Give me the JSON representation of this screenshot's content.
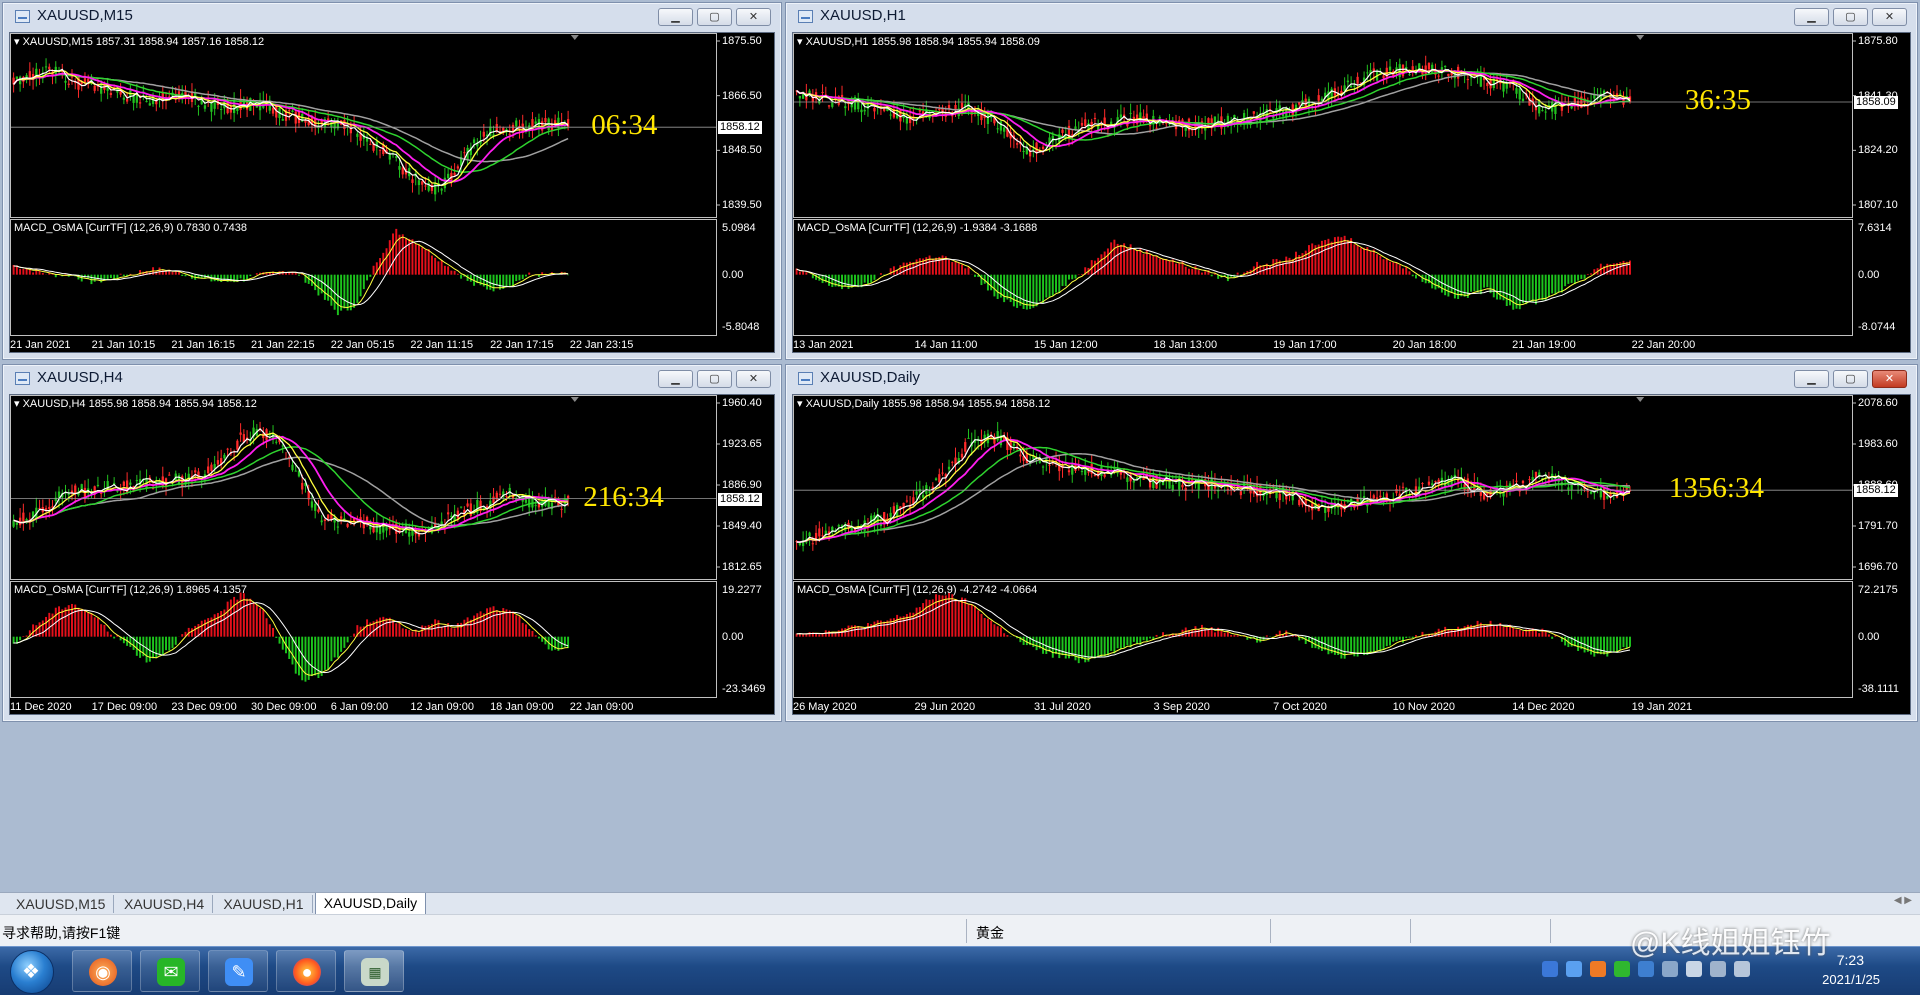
{
  "windows": [
    {
      "id": "m15",
      "title": "XAUUSD,M15",
      "info_line": "XAUUSD,M15  1857.31 1858.94 1857.16 1858.12",
      "timer": "06:34",
      "price_tag": "1858.12",
      "price_axis": [
        "1875.50",
        "1866.50",
        "1848.50",
        "1839.50"
      ],
      "macd_label": "MACD_OsMA [CurrTF] (12,26,9) 0.7830 0.7438",
      "macd_axis": [
        "5.0984",
        "0.00",
        "-5.8048"
      ],
      "time_axis": [
        "21 Jan 2021",
        "21 Jan 10:15",
        "21 Jan 16:15",
        "21 Jan 22:15",
        "22 Jan 05:15",
        "22 Jan 11:15",
        "22 Jan 17:15",
        "22 Jan 23:15"
      ],
      "close_red": false
    },
    {
      "id": "h1",
      "title": "XAUUSD,H1",
      "info_line": "XAUUSD,H1  1855.98 1858.94 1855.94 1858.09",
      "timer": "36:35",
      "price_tag": "1858.09",
      "price_axis": [
        "1875.80",
        "1841.30",
        "1824.20",
        "1807.10"
      ],
      "macd_label": "MACD_OsMA [CurrTF] (12,26,9) -1.9384 -3.1688",
      "macd_axis": [
        "7.6314",
        "0.00",
        "-8.0744"
      ],
      "time_axis": [
        "13 Jan 2021",
        "14 Jan 11:00",
        "15 Jan 12:00",
        "18 Jan 13:00",
        "19 Jan 17:00",
        "20 Jan 18:00",
        "21 Jan 19:00",
        "22 Jan 20:00"
      ],
      "close_red": false
    },
    {
      "id": "h4",
      "title": "XAUUSD,H4",
      "info_line": "XAUUSD,H4  1855.98 1858.94 1855.94 1858.12",
      "timer": "216:34",
      "price_tag": "1858.12",
      "price_axis": [
        "1960.40",
        "1923.65",
        "1886.90",
        "1849.40",
        "1812.65"
      ],
      "macd_label": "MACD_OsMA [CurrTF] (12,26,9) 1.8965 4.1357",
      "macd_axis": [
        "19.2277",
        "0.00",
        "-23.3469"
      ],
      "time_axis": [
        "11 Dec 2020",
        "17 Dec 09:00",
        "23 Dec 09:00",
        "30 Dec 09:00",
        "6 Jan 09:00",
        "12 Jan 09:00",
        "18 Jan 09:00",
        "22 Jan 09:00"
      ],
      "close_red": false
    },
    {
      "id": "d1",
      "title": "XAUUSD,Daily",
      "info_line": "XAUUSD,Daily  1855.98 1858.94 1855.94 1858.12",
      "timer": "1356:34",
      "price_tag": "1858.12",
      "price_axis": [
        "2078.60",
        "1983.60",
        "1888.60",
        "1791.70",
        "1696.70"
      ],
      "macd_label": "MACD_OsMA [CurrTF] (12,26,9) -4.2742 -4.0664",
      "macd_axis": [
        "72.2175",
        "0.00",
        "-38.1111"
      ],
      "time_axis": [
        "26 May 2020",
        "29 Jun 2020",
        "31 Jul 2020",
        "3 Sep 2020",
        "7 Oct 2020",
        "10 Nov 2020",
        "14 Dec 2020",
        "19 Jan 2021"
      ],
      "close_red": true
    }
  ],
  "tabs": [
    "XAUUSD,M15",
    "XAUUSD,H4",
    "XAUUSD,H1",
    "XAUUSD,Daily"
  ],
  "active_tab": "XAUUSD,Daily",
  "status": {
    "help": "寻求帮助,请按F1键",
    "symbol": "黄金"
  },
  "taskbar": {
    "time": "7:23",
    "date": "2021/1/25",
    "watermark": "@K线姐姐钰竹",
    "apps": [
      "firefox-like-app",
      "wechat-app",
      "feishu-app",
      "firefox-app",
      "chart-app"
    ]
  },
  "colors": {
    "bull_candle": "#22c11f",
    "bear_candle": "#ff2a2a",
    "ma_white": "#ffffff",
    "ma_yellow": "#ffff40",
    "ma_magenta": "#ff1ef0",
    "ma_green": "#2ed32e",
    "ma_gray": "#a0a0a0",
    "timer": "#ffe600",
    "macd_pos": "#e5101b",
    "macd_neg": "#1dc41d"
  },
  "window_buttons": {
    "minimize": "▁",
    "maximize": "▢",
    "close": "✕"
  }
}
